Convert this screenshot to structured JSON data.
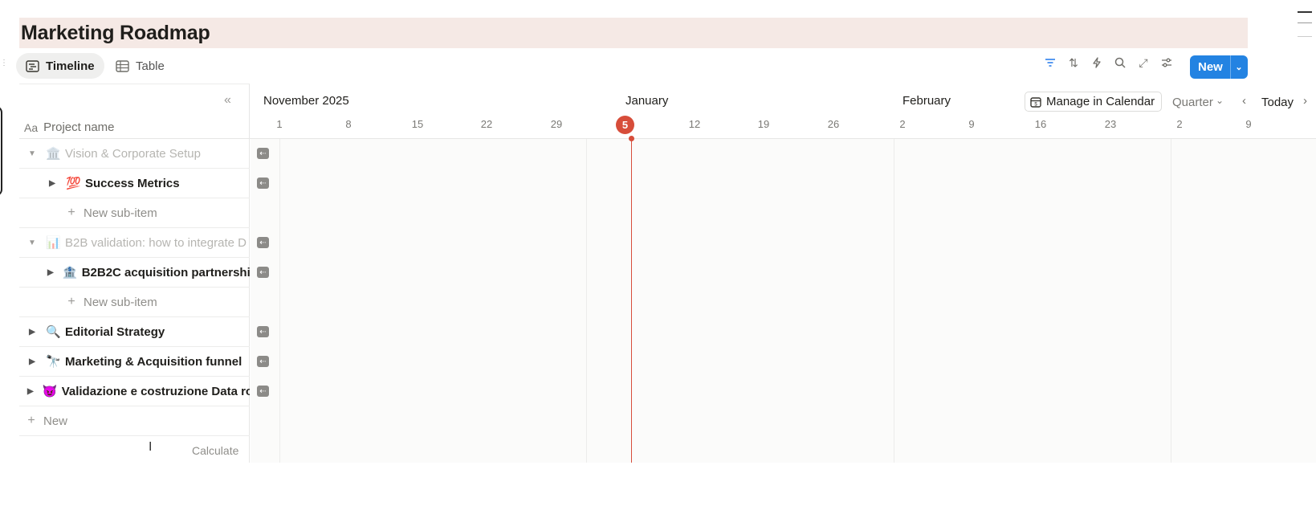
{
  "page": {
    "title": "Marketing Roadmap"
  },
  "views": [
    {
      "label": "Timeline",
      "active": true
    },
    {
      "label": "Table",
      "active": false
    }
  ],
  "toolbar": {
    "icons": [
      "filter-icon",
      "sort-icon",
      "automation-icon",
      "search-icon",
      "expand-icon",
      "settings-icon"
    ],
    "new_label": "New"
  },
  "left_panel": {
    "column_header": "Project name",
    "column_header_icon": "Aa",
    "rows": [
      {
        "label": "Vision & Corporate Setup",
        "emoji": "🏛️",
        "level": 0,
        "expanded": true,
        "faded": true
      },
      {
        "label": "Success Metrics",
        "emoji": "💯",
        "level": 1,
        "expanded": false,
        "faded": false
      },
      {
        "label": "New sub-item",
        "type": "new-sub-item",
        "level": 1
      },
      {
        "label": "B2B validation: how to integrate D",
        "emoji": "📊",
        "level": 0,
        "expanded": true,
        "faded": true
      },
      {
        "label": "B2B2C acquisition partnershi",
        "emoji": "🏦",
        "level": 1,
        "expanded": false,
        "faded": false
      },
      {
        "label": "New sub-item",
        "type": "new-sub-item",
        "level": 1
      },
      {
        "label": "Editorial Strategy",
        "emoji": "🔍",
        "level": 0,
        "expanded": false,
        "faded": false
      },
      {
        "label": "Marketing & Acquisition funnel",
        "emoji": "🔭",
        "level": 0,
        "expanded": false,
        "faded": false
      },
      {
        "label": "Validazione e costruzione Data ro",
        "emoji": "😈",
        "level": 0,
        "expanded": false,
        "faded": false
      }
    ],
    "new_label": "New",
    "calculate_label": "Calculate"
  },
  "timeline": {
    "months": [
      "November 2025",
      "January",
      "February"
    ],
    "ticks": [
      "1",
      "8",
      "15",
      "22",
      "29",
      "5",
      "12",
      "19",
      "26",
      "2",
      "9",
      "16",
      "23",
      "2",
      "9"
    ],
    "today_day": "5",
    "manage_label": "Manage in Calendar",
    "range_label": "Quarter",
    "today_label": "Today"
  },
  "colors": {
    "accent": "#2383e2",
    "today": "#d74d3a",
    "title_band": "#f5e9e5"
  }
}
